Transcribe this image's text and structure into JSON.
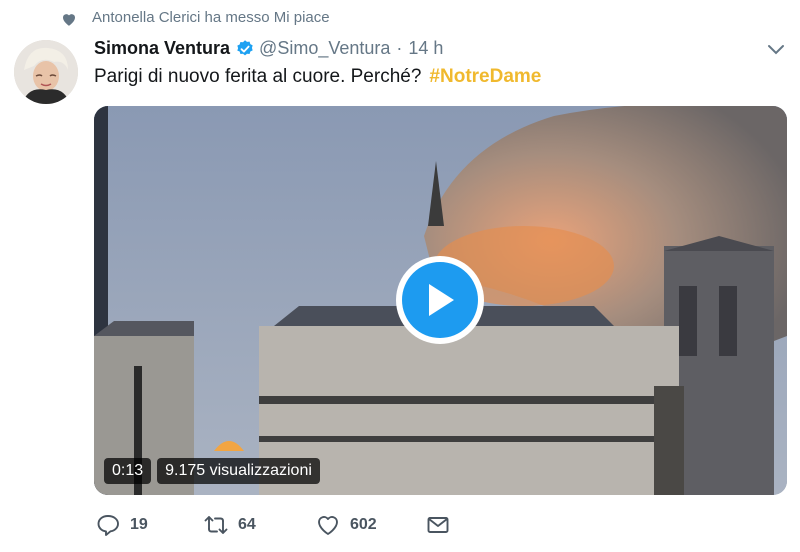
{
  "context": {
    "text": "Antonella Clerici ha messo Mi piace"
  },
  "tweet": {
    "author_name": "Simona Ventura",
    "handle": "@Simo_Ventura",
    "separator": "·",
    "time": "14 h",
    "text": "Parigi di nuovo ferita al cuore. Perché?",
    "hashtag": "#NotreDame"
  },
  "video": {
    "duration": "0:13",
    "views": "9.175 visualizzazioni"
  },
  "actions": {
    "replies": "19",
    "retweets": "64",
    "likes": "602"
  },
  "colors": {
    "hashtag": "#f0b92e",
    "play_button": "#1d9bf0",
    "muted_text": "#657786"
  },
  "icons": [
    "heart-icon",
    "verified-badge-icon",
    "chevron-down-icon",
    "play-icon",
    "reply-icon",
    "retweet-icon",
    "like-icon",
    "direct-message-icon"
  ]
}
